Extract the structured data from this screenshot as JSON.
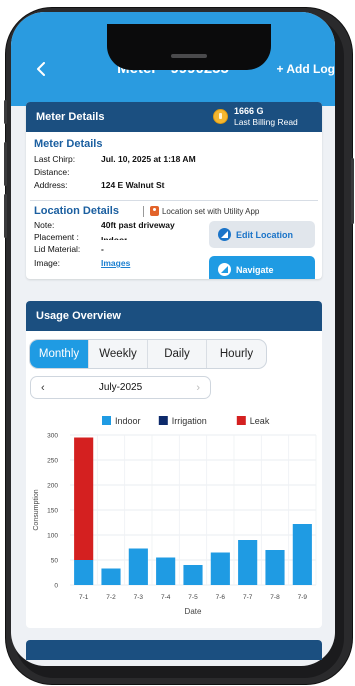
{
  "appbar": {
    "title": "Meter - 9990255",
    "add_log": "+ Add Log"
  },
  "meter_card": {
    "header": "Meter Details",
    "billing_value": "1666 G",
    "billing_label": "Last Billing Read",
    "section_title": "Meter Details",
    "rows": [
      {
        "key": "Last Chirp:",
        "value": "Jul. 10, 2025 at 1:18 AM"
      },
      {
        "key": "Distance:",
        "value": ""
      },
      {
        "key": "Address:",
        "value": "124 E Walnut St"
      }
    ]
  },
  "location": {
    "title": "Location Details",
    "note": "Location set with Utility App",
    "rows": [
      {
        "key": "Note:",
        "value": "40ft past driveway"
      },
      {
        "key": "Placement :",
        "value": "Indoor"
      },
      {
        "key": "Lid Material:",
        "value": "-"
      }
    ],
    "image_key": "Image:",
    "image_link": "Images",
    "edit_button": "Edit Location",
    "navigate_button": "Navigate"
  },
  "usage": {
    "header": "Usage Overview",
    "tabs": [
      "Monthly",
      "Weekly",
      "Daily",
      "Hourly"
    ],
    "active_tab": "Monthly",
    "month": "July-2025"
  },
  "colors": {
    "appbar": "#2a9be0",
    "header": "#1b4f80",
    "indoor": "#1f9be3",
    "irrigation": "#0d2a6b",
    "leak": "#d42020"
  },
  "chart_data": {
    "type": "bar",
    "stacked": true,
    "categories": [
      "7-1",
      "7-2",
      "7-3",
      "7-4",
      "7-5",
      "7-6",
      "7-7",
      "7-8",
      "7-9"
    ],
    "series": [
      {
        "name": "Indoor",
        "values": [
          50,
          33,
          73,
          55,
          40,
          65,
          90,
          70,
          122
        ]
      },
      {
        "name": "Irrigation",
        "values": [
          0,
          0,
          0,
          0,
          0,
          0,
          0,
          0,
          0
        ]
      },
      {
        "name": "Leak",
        "values": [
          245,
          0,
          0,
          0,
          0,
          0,
          0,
          0,
          0
        ]
      }
    ],
    "yticks": [
      "0",
      "50",
      "100",
      "150",
      "200",
      "250",
      "300"
    ],
    "ylim": [
      0,
      300
    ],
    "xlabel": "Date",
    "ylabel": "Consumption",
    "legend": "top",
    "grid": true
  }
}
